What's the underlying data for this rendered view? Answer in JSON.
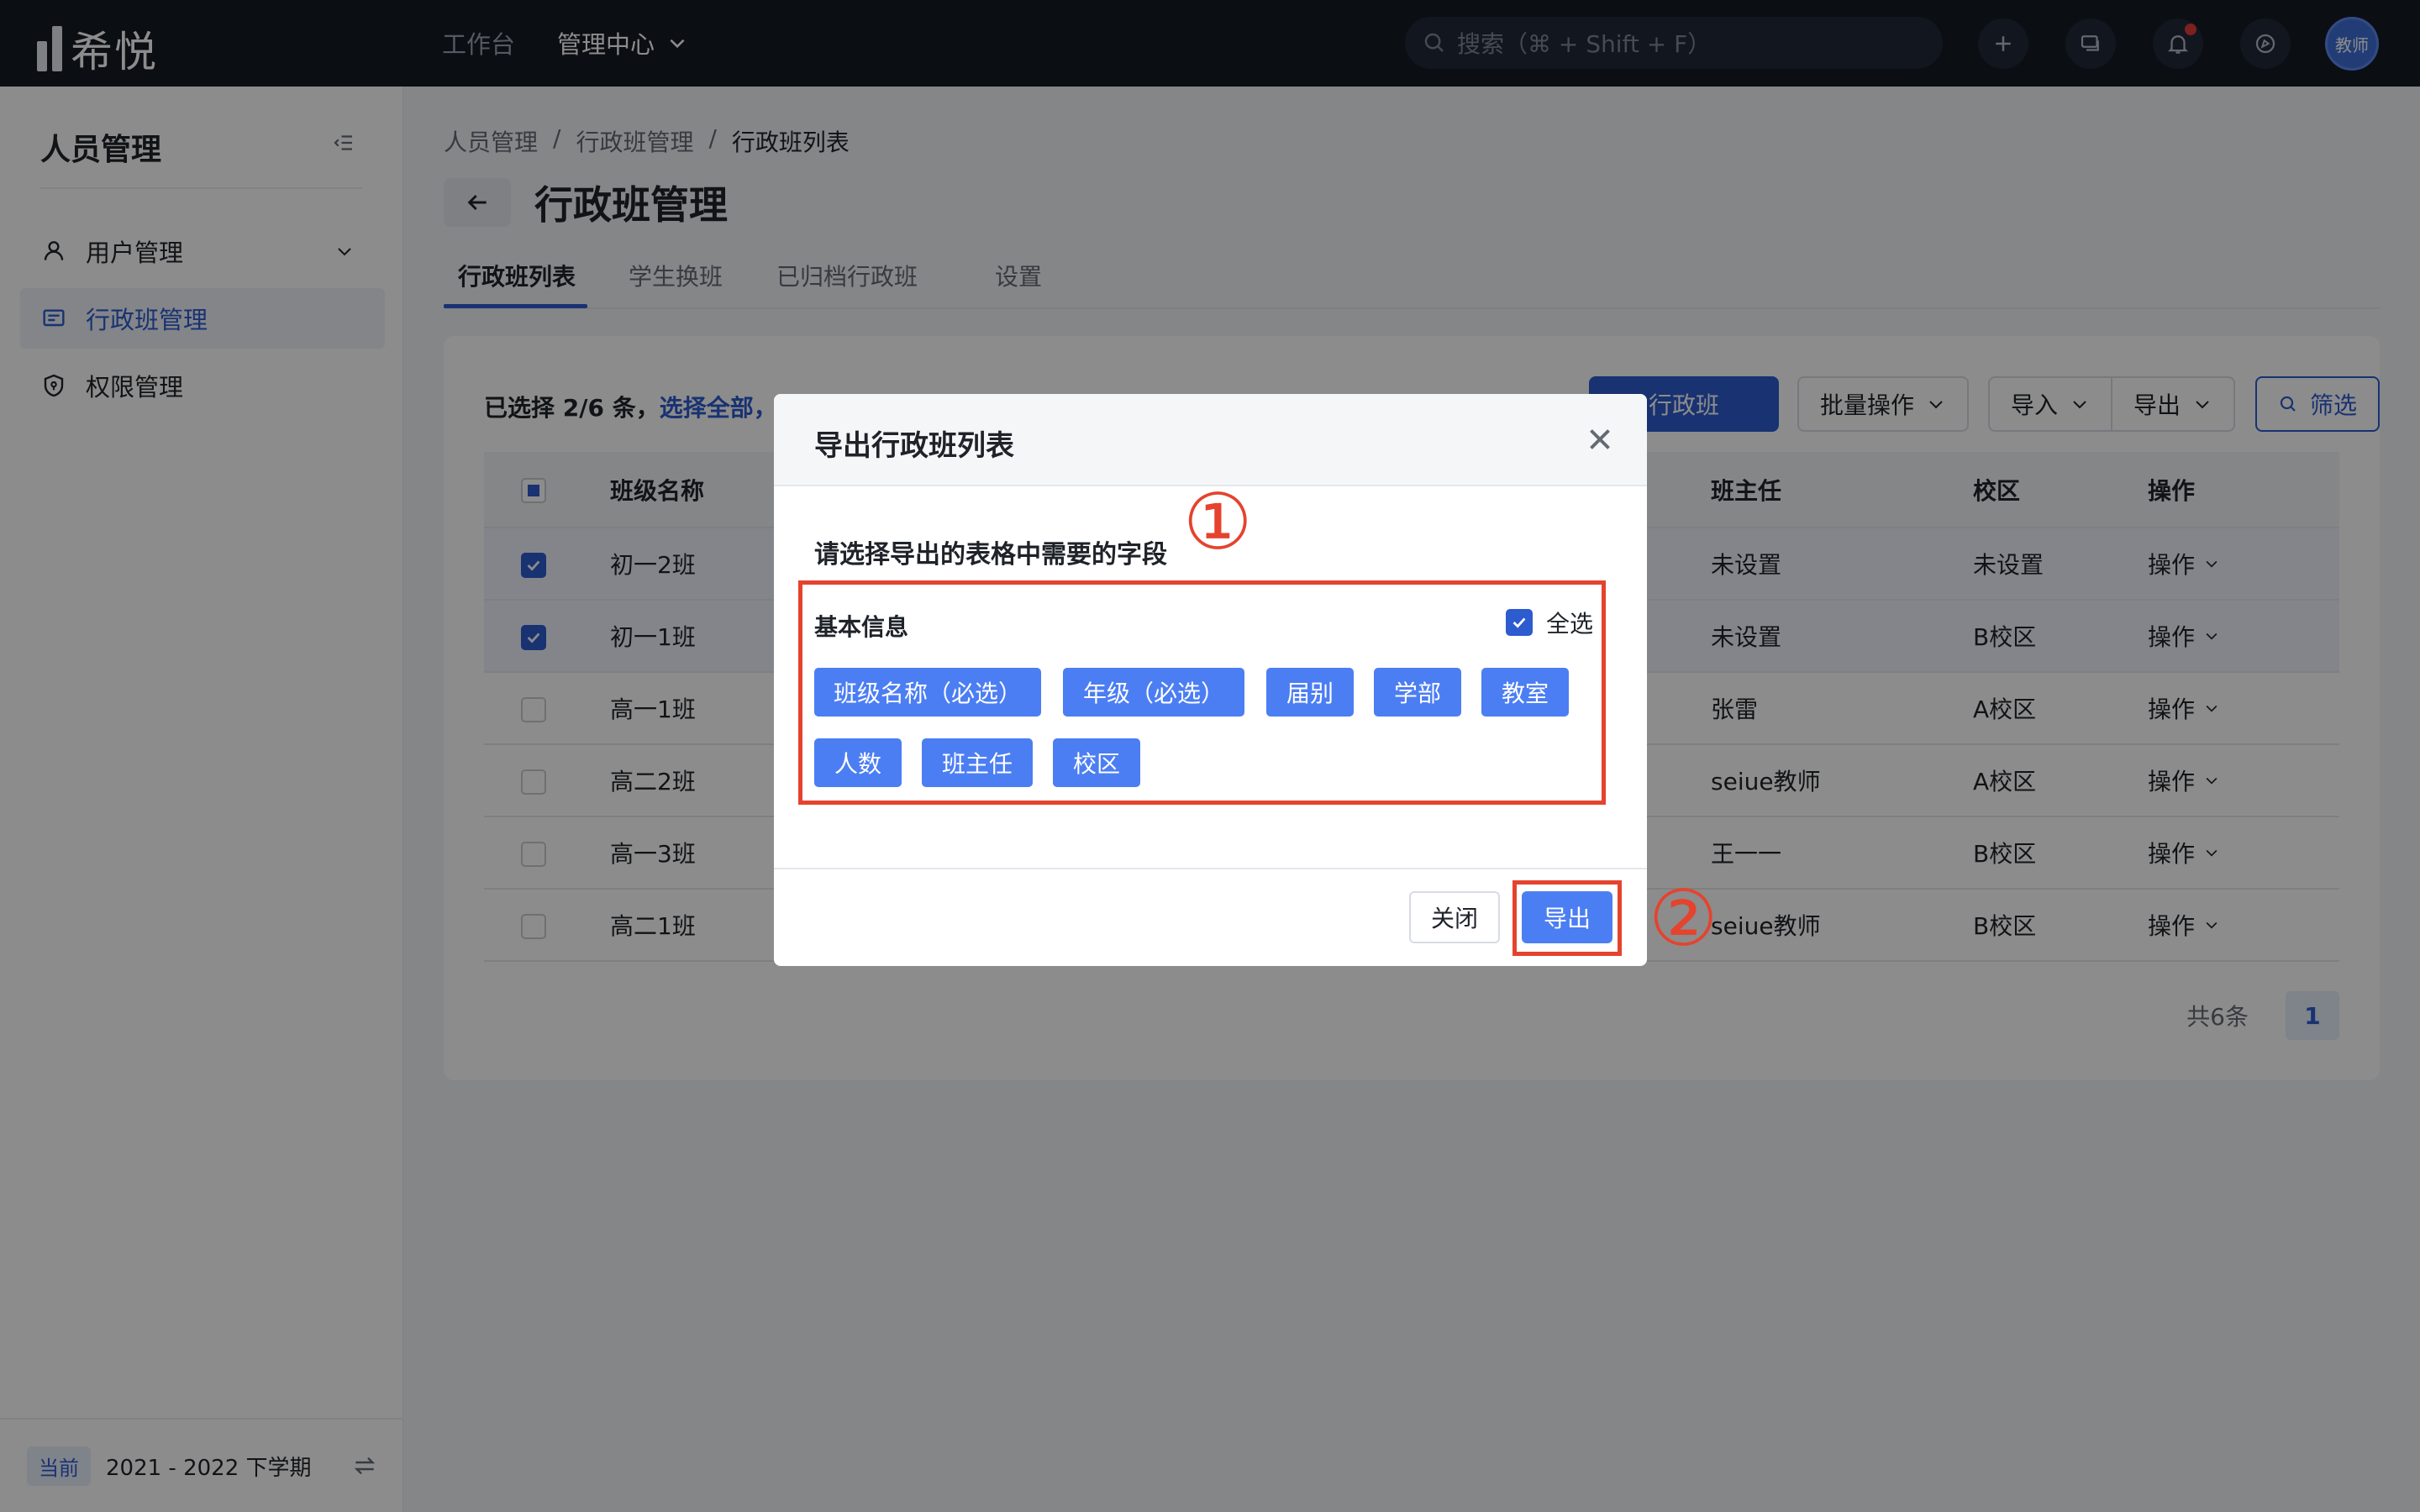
{
  "topbar": {
    "logo_text": "希悦",
    "nav": [
      {
        "label": "工作台"
      },
      {
        "label": "管理中心"
      }
    ],
    "search_placeholder": "搜索（⌘ + Shift + F）",
    "avatar_text": "教师"
  },
  "sidebar": {
    "title": "人员管理",
    "items": [
      {
        "label": "用户管理"
      },
      {
        "label": "行政班管理"
      },
      {
        "label": "权限管理"
      }
    ],
    "footer": {
      "badge": "当前",
      "term": "2021 - 2022 下学期"
    }
  },
  "breadcrumb": [
    "人员管理",
    "行政班管理",
    "行政班列表"
  ],
  "page_title": "行政班管理",
  "tabs": [
    "行政班列表",
    "学生换班",
    "已归档行政班",
    "设置"
  ],
  "toolbar": {
    "selection_prefix": "已选择 2/6 条，",
    "select_all": "选择全部，",
    "add_label": "行政班",
    "batch_label": "批量操作",
    "import_label": "导入",
    "export_label": "导出",
    "filter_label": "筛选"
  },
  "table": {
    "headers": [
      "班级名称",
      "班主任",
      "校区",
      "操作"
    ],
    "rows": [
      {
        "name": "初一2班",
        "teacher": "未设置",
        "campus": "未设置",
        "op": "操作",
        "checked": true
      },
      {
        "name": "初一1班",
        "teacher": "未设置",
        "campus": "B校区",
        "op": "操作",
        "checked": true
      },
      {
        "name": "高一1班",
        "teacher": "张雷",
        "campus": "A校区",
        "op": "操作",
        "checked": false
      },
      {
        "name": "高二2班",
        "teacher": "seiue教师",
        "campus": "A校区",
        "op": "操作",
        "checked": false
      },
      {
        "name": "高一3班",
        "teacher": "王一一",
        "campus": "B校区",
        "op": "操作",
        "checked": false
      },
      {
        "name": "高二1班",
        "teacher": "seiue教师",
        "campus": "B校区",
        "op": "操作",
        "checked": false
      }
    ]
  },
  "pager": {
    "total": "共6条",
    "page": "1"
  },
  "modal": {
    "title": "导出行政班列表",
    "subtitle": "请选择导出的表格中需要的字段",
    "section": "基本信息",
    "select_all": "全选",
    "tags": [
      "班级名称（必选）",
      "年级（必选）",
      "届别",
      "学部",
      "教室",
      "人数",
      "班主任",
      "校区"
    ],
    "close_label": "关闭",
    "export_label": "导出"
  },
  "annotations": {
    "step1": "①",
    "step2": "②",
    "color": "#e5432e"
  },
  "colors": {
    "accent": "#2d5bd0",
    "tag": "#4c7ef3",
    "topbar": "#141a24"
  }
}
